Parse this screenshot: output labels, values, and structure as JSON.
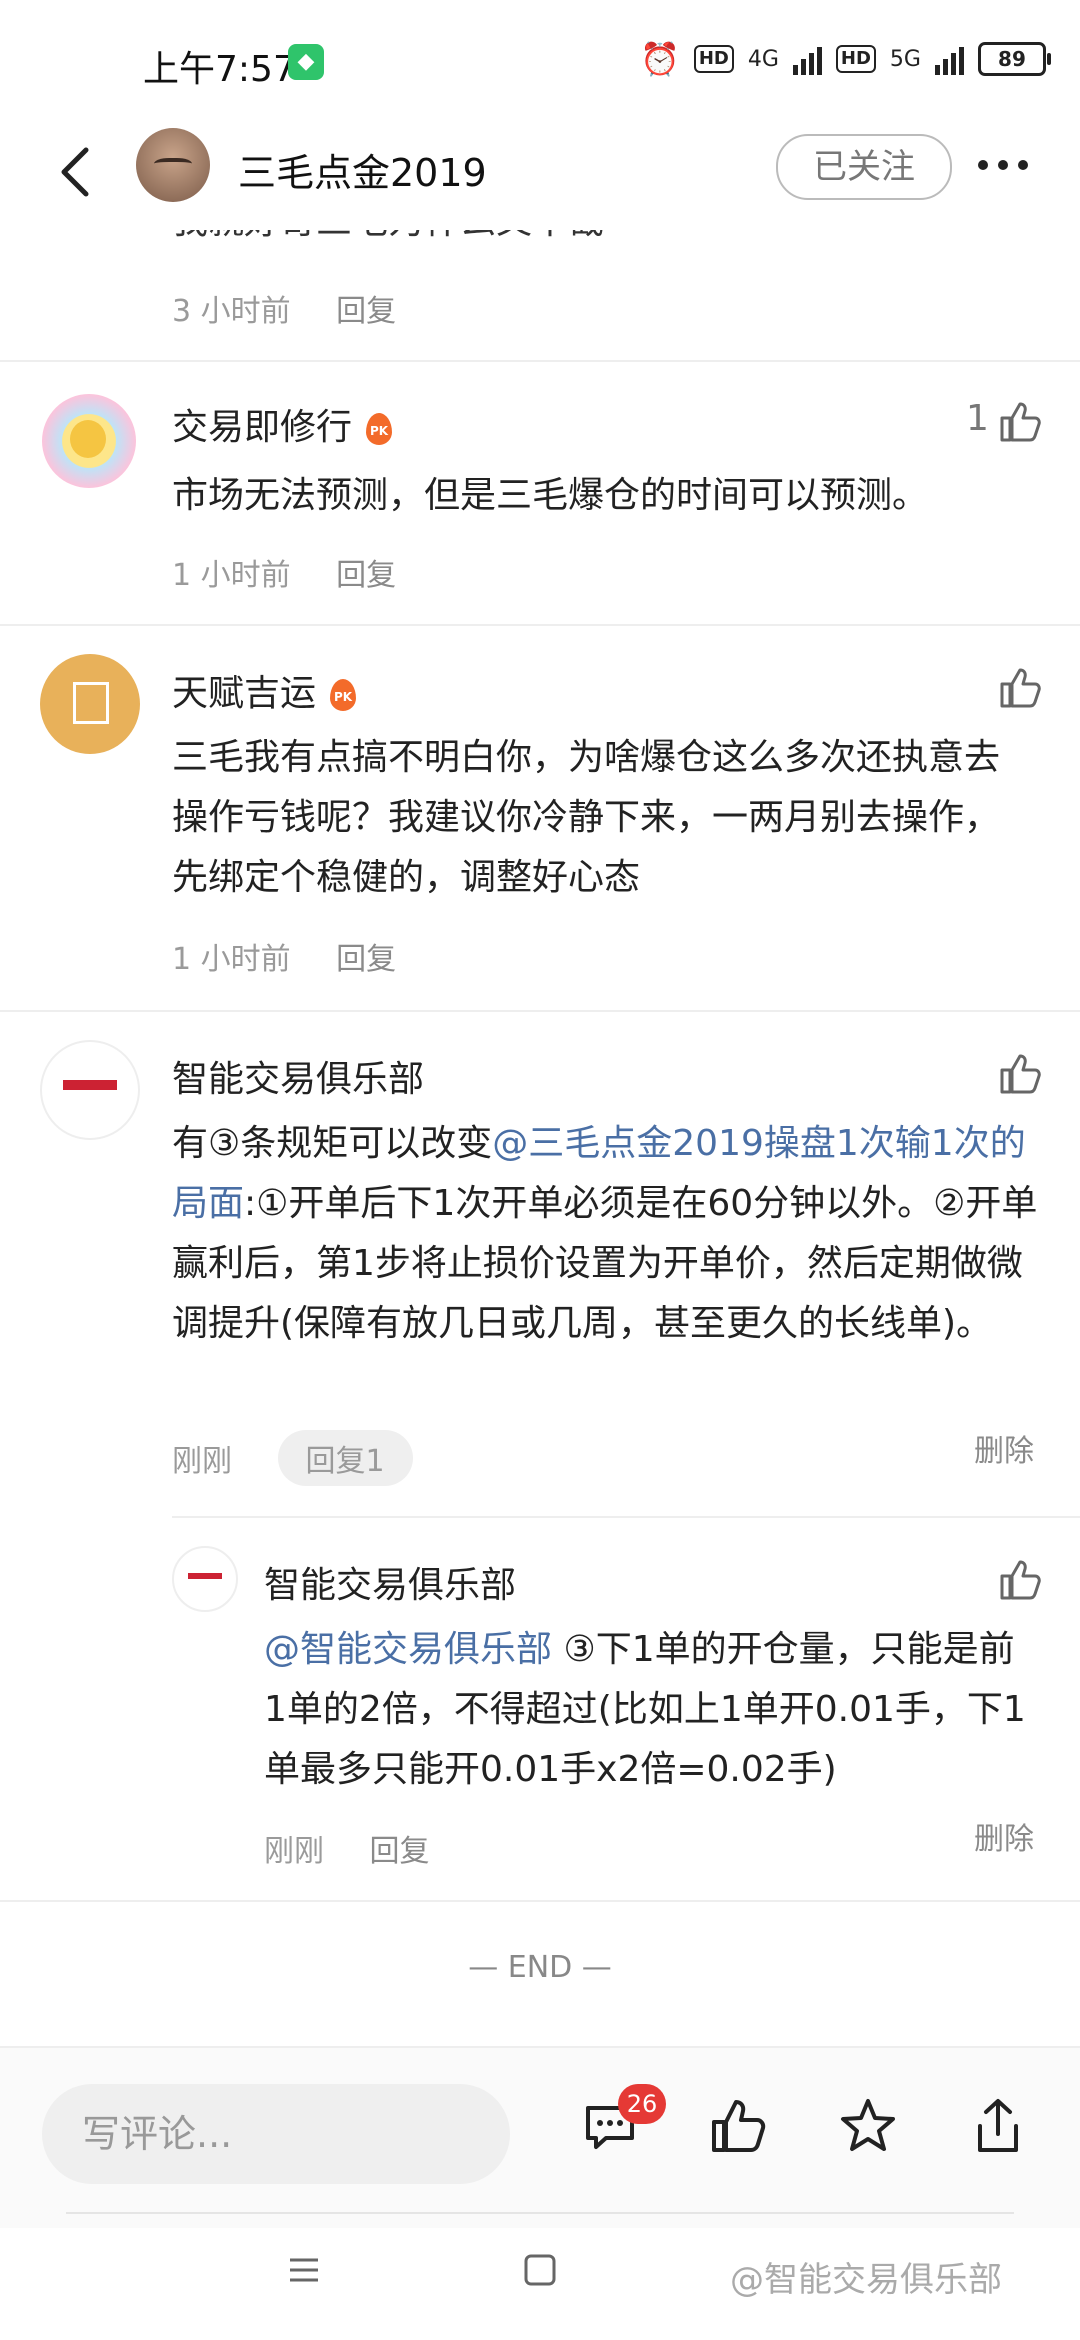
{
  "status_bar": {
    "time": "上午7:57",
    "net1": "4G",
    "net2": "5G",
    "hd": "HD",
    "battery": "89"
  },
  "header": {
    "title": "三毛点金2019",
    "follow_label": "已关注"
  },
  "partial_comment": {
    "clipped_text": "我就好奇三毛为什么又不截",
    "time": "3 小时前",
    "reply": "回复"
  },
  "comments": [
    {
      "name": "交易即修行",
      "likes": "1",
      "text": "市场无法预测，但是三毛爆仓的时间可以预测。",
      "time": "1 小时前",
      "reply": "回复"
    },
    {
      "name": "天赋吉运",
      "text": "三毛我有点搞不明白你，为啥爆仓这么多次还执意去操作亏钱呢？我建议你冷静下来，一两月别去操作，先绑定个稳健的，调整好心态",
      "time": "1 小时前",
      "reply": "回复"
    },
    {
      "name": "智能交易俱乐部",
      "text_pre": "有③条规矩可以改变",
      "mention": "@三毛点金2019操盘1次输1次的局面",
      "text_post": ":①开单后下1次开单必须是在60分钟以外。②开单赢利后，第1步将止损价设置为开单价，然后定期做微调提升(保障有放几日或几周，甚至更久的长线单)。",
      "time": "刚刚",
      "reply": "回复1",
      "delete": "删除"
    }
  ],
  "reply": {
    "name": "智能交易俱乐部",
    "mention": "@智能交易俱乐部",
    "text": " ③下1单的开仓量，只能是前1单的2倍，不得超过(比如上1单开0.01手，下1单最多只能开0.01手x2倍=0.02手)",
    "time": "刚刚",
    "reply": "回复",
    "delete": "删除"
  },
  "end_label": "— END —",
  "bottom_bar": {
    "input_placeholder": "写评论...",
    "comment_count": "26"
  },
  "watermark": "@智能交易俱乐部",
  "icons": [
    "back-icon",
    "more-icon",
    "like-icon",
    "comment-icon",
    "star-icon",
    "share-icon",
    "pk-badge-icon",
    "menu-nav-icon",
    "home-nav-icon"
  ]
}
